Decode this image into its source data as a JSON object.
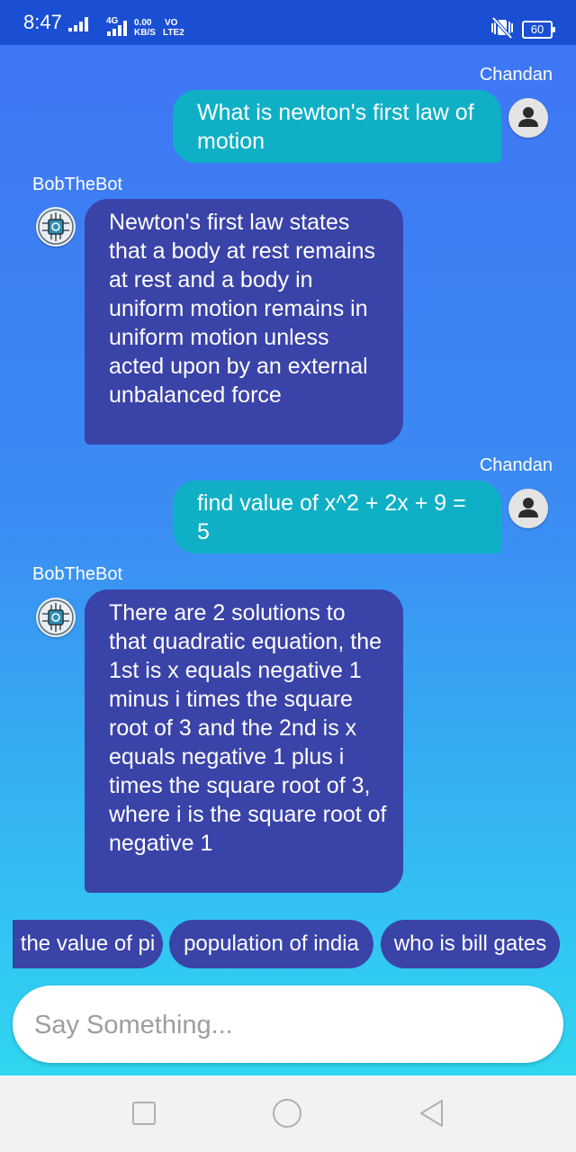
{
  "status_bar": {
    "time": "8:47",
    "network_gen": "4G",
    "speed_value": "0.00",
    "speed_unit": "KB/S",
    "volte_top": "VO",
    "volte_bottom": "LTE2",
    "battery": "60"
  },
  "messages": [
    {
      "sender": "Chandan",
      "role": "user",
      "text": "What is newton's first law of motion"
    },
    {
      "sender": "BobTheBot",
      "role": "bot",
      "text": "Newton's first law states that a body at rest remains at rest and a body in uniform motion remains in uniform motion unless acted upon by an external unbalanced force"
    },
    {
      "sender": "Chandan",
      "role": "user",
      "text": "find value of x^2 + 2x + 9 = 5"
    },
    {
      "sender": "BobTheBot",
      "role": "bot",
      "text": "There are 2 solutions to that quadratic equation, the 1st is x equals negative 1 minus i times the square root of 3 and the 2nd is x equals negative 1 plus i times the square root of 3, where i is the square root of negative 1"
    }
  ],
  "suggestions": [
    "the value of pi",
    "population of india",
    "who is bill gates"
  ],
  "input": {
    "placeholder": "Say Something..."
  },
  "colors": {
    "user_bubble": "#0fb0c6",
    "bot_bubble": "#3a43a8",
    "status_bar": "#1a4fd4"
  }
}
